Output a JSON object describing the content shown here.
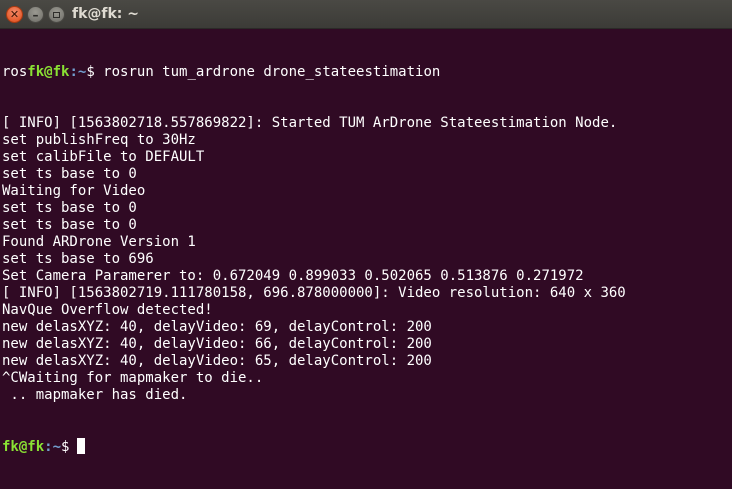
{
  "window": {
    "title": "fk@fk: ~",
    "close_glyph": "✕",
    "minimize_glyph": "–"
  },
  "terminal": {
    "first_prompt": {
      "prefix": "ros",
      "user": "fk@fk",
      "path": ":~",
      "symbol": "$ ",
      "command": "rosrun tum_ardrone drone_stateestimation"
    },
    "output_lines": [
      "[ INFO] [1563802718.557869822]: Started TUM ArDrone Stateestimation Node.",
      "set publishFreq to 30Hz",
      "set calibFile to DEFAULT",
      "set ts base to 0",
      "Waiting for Video",
      "set ts base to 0",
      "set ts base to 0",
      "Found ARDrone Version 1",
      "set ts base to 696",
      "Set Camera Paramerer to: 0.672049 0.899033 0.502065 0.513876 0.271972",
      "[ INFO] [1563802719.111780158, 696.878000000]: Video resolution: 640 x 360",
      "NavQue Overflow detected!",
      "new delasXYZ: 40, delayVideo: 69, delayControl: 200",
      "new delasXYZ: 40, delayVideo: 66, delayControl: 200",
      "new delasXYZ: 40, delayVideo: 65, delayControl: 200",
      "^CWaiting for mapmaker to die..",
      " .. mapmaker has died."
    ],
    "last_prompt": {
      "user": "fk@fk",
      "path": ":~",
      "symbol": "$"
    }
  },
  "colors": {
    "background": "#300a24",
    "prompt_user": "#8ae234",
    "prompt_path": "#729fcf",
    "text": "#ffffff"
  }
}
